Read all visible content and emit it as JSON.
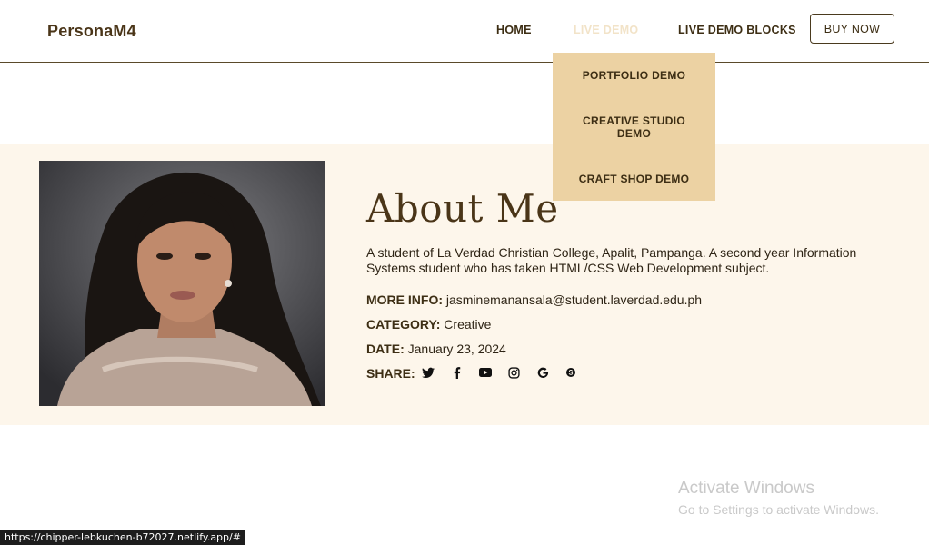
{
  "header": {
    "brand": "PersonaM4",
    "nav": {
      "home": "HOME",
      "live_demo": "LIVE DEMO",
      "live_demo_blocks": "LIVE DEMO BLOCKS"
    },
    "buy_now": "BUY NOW"
  },
  "dropdown": {
    "items": [
      "PORTFOLIO DEMO",
      "CREATIVE STUDIO DEMO",
      "CRAFT SHOP DEMO"
    ]
  },
  "about": {
    "title": "About Me",
    "description": "A student of La Verdad Christian College, Apalit, Pampanga. A second year Information Systems student who has taken HTML/CSS Web Development subject.",
    "more_info_label": "MORE INFO:",
    "more_info_value": "jasminemanansala@student.laverdad.edu.ph",
    "category_label": "CATEGORY:",
    "category_value": "Creative",
    "date_label": "DATE:",
    "date_value": "January 23, 2024",
    "share_label": "SHARE:",
    "share_icons": [
      "twitter-icon",
      "facebook-icon",
      "youtube-icon",
      "instagram-icon",
      "google-icon",
      "skype-icon"
    ]
  },
  "overlay": {
    "activate_title": "Activate Windows",
    "activate_sub": "Go to Settings to activate Windows.",
    "status_url": "https://chipper-lebkuchen-b72027.netlify.app/#"
  },
  "colors": {
    "accent": "#ecd2a3",
    "section_bg": "#fdf6eb",
    "text_dark": "#3d2e14"
  }
}
